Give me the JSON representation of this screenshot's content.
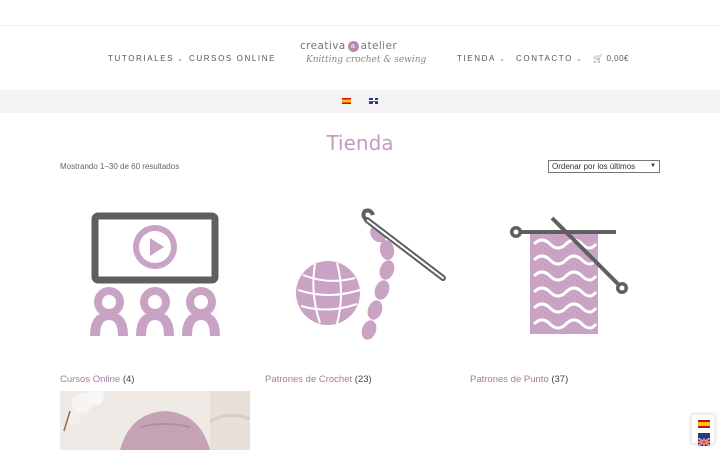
{
  "nav": {
    "tutoriales": "TUTORIALES",
    "cursos_online": "CURSOS ONLINE",
    "tienda": "TIENDA",
    "contacto": "CONTACTO",
    "cart_total": "0,00€"
  },
  "logo": {
    "part1": "creativa",
    "mark": "a",
    "part2": "atelier",
    "tagline": "Knitting crochet & sewing"
  },
  "languages": [
    "es",
    "en"
  ],
  "page": {
    "title": "Tienda",
    "result_count": "Mostrando 1–30 de 60 resultados",
    "ordering_selected": "Ordenar por los últimos"
  },
  "categories": [
    {
      "name": "Cursos Online",
      "count": "(4)",
      "icon": "online-course-icon"
    },
    {
      "name": "Patrones de Crochet",
      "count": "(23)",
      "icon": "yarn-crochet-icon"
    },
    {
      "name": "Patrones de Punto",
      "count": "(37)",
      "icon": "knitting-needles-icon"
    }
  ],
  "colors": {
    "accent": "#c49bbd",
    "link": "#a77aa0",
    "icon_gray": "#5f5f5f"
  }
}
